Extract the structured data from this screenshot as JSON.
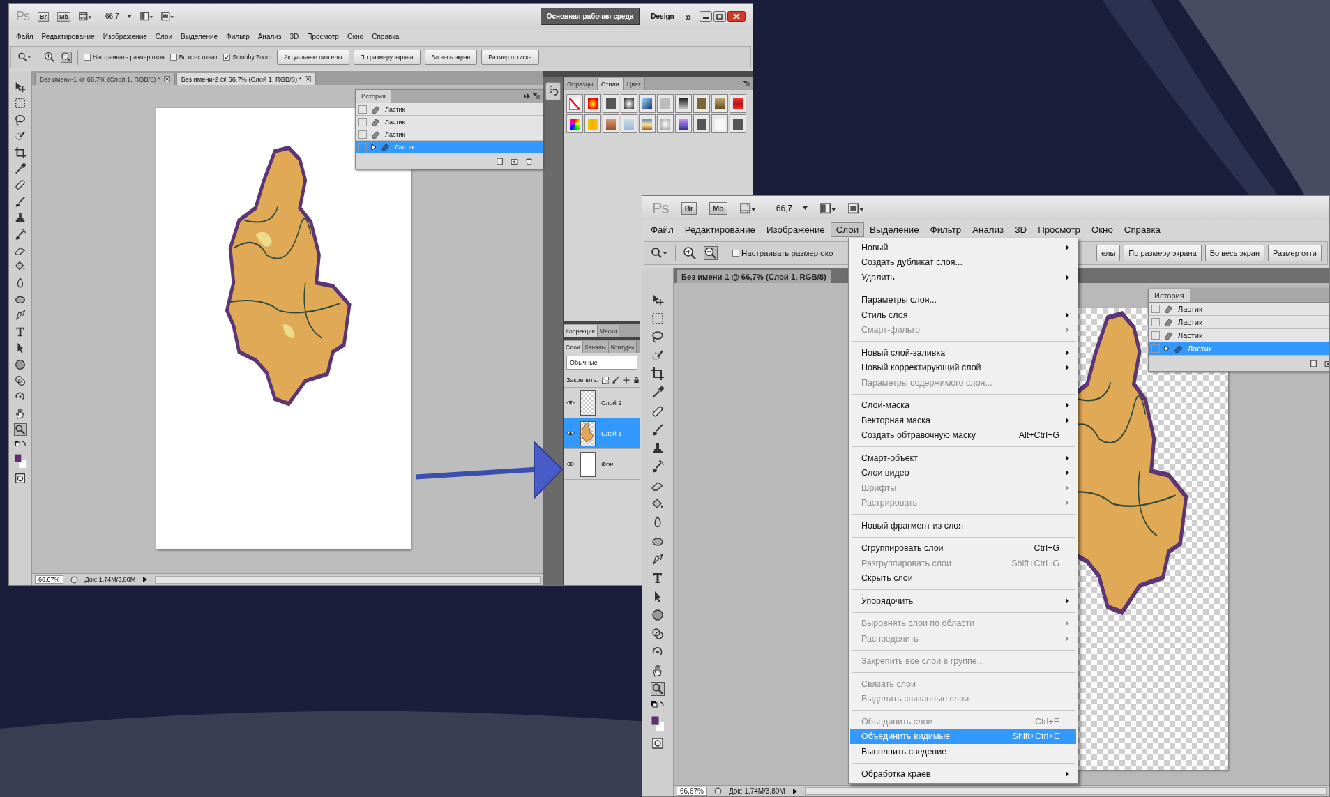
{
  "left_window": {
    "logo": "Ps",
    "bridge": "Br",
    "mini_bridge": "Mb",
    "zoom": "66,7",
    "workspace": "Основная рабочая среда",
    "workspace_alt": "Design",
    "more": "»",
    "menu": [
      {
        "label": "Файл",
        "selected": false
      },
      {
        "label": "Редактирование",
        "selected": false
      },
      {
        "label": "Изображение",
        "selected": false
      },
      {
        "label": "Слои",
        "selected": false
      },
      {
        "label": "Выделение",
        "selected": false
      },
      {
        "label": "Фильтр",
        "selected": false
      },
      {
        "label": "Анализ",
        "selected": false
      },
      {
        "label": "3D",
        "selected": false
      },
      {
        "label": "Просмотр",
        "selected": false
      },
      {
        "label": "Окно",
        "selected": false
      },
      {
        "label": "Справка",
        "selected": false
      }
    ],
    "options": {
      "checkboxes": [
        {
          "label": "Настраивать размер окон",
          "checked": false
        },
        {
          "label": "Во всех окнах",
          "checked": false
        },
        {
          "label": "Scrubby Zoom",
          "checked": true
        }
      ],
      "buttons": [
        "Актуальные пикселы",
        "По размеру экрана",
        "Во весь экран",
        "Размер оттиска"
      ]
    },
    "tabs": [
      {
        "label": "Без имени-1 @ 66,7% (Слой 1, RGB/8) *",
        "selected": false
      },
      {
        "label": "Без имени-2 @ 66,7% (Слой 1, RGB/8) *",
        "selected": true
      }
    ],
    "history": {
      "title": "История",
      "items": [
        {
          "label": "Ластик",
          "selected": false
        },
        {
          "label": "Ластик",
          "selected": false
        },
        {
          "label": "Ластик",
          "selected": false
        },
        {
          "label": "Ластик",
          "selected": true
        }
      ]
    },
    "styles_panel": {
      "tabs": [
        {
          "label": "Образцы",
          "selected": false
        },
        {
          "label": "Стили",
          "selected": true
        },
        {
          "label": "Цвет",
          "selected": false
        }
      ]
    },
    "adjust_panel": {
      "tabs": [
        {
          "label": "Коррекция",
          "selected": true
        },
        {
          "label": "Маски",
          "selected": false
        }
      ]
    },
    "layers_panel": {
      "tabs": [
        {
          "label": "Слои",
          "selected": true
        },
        {
          "label": "Каналы",
          "selected": false
        },
        {
          "label": "Контуры",
          "selected": false
        }
      ],
      "blend_mode": "Обычные",
      "lock_label": "Закрепить:",
      "layers": [
        {
          "name": "Слой 2",
          "kind": "empty",
          "selected": false
        },
        {
          "name": "Слой 1",
          "kind": "map",
          "selected": true
        },
        {
          "name": "Фон",
          "kind": "background",
          "selected": false
        }
      ]
    },
    "status": {
      "zoom": "66,67%",
      "doc": "Док: 1,74M/3,80M"
    }
  },
  "right_window": {
    "logo": "Ps",
    "bridge": "Br",
    "mini_bridge": "Mb",
    "zoom": "66,7",
    "menu": [
      {
        "label": "Файл",
        "selected": false
      },
      {
        "label": "Редактирование",
        "selected": false
      },
      {
        "label": "Изображение",
        "selected": false
      },
      {
        "label": "Слои",
        "selected": true
      },
      {
        "label": "Выделение",
        "selected": false
      },
      {
        "label": "Фильтр",
        "selected": false
      },
      {
        "label": "Анализ",
        "selected": false
      },
      {
        "label": "3D",
        "selected": false
      },
      {
        "label": "Просмотр",
        "selected": false
      },
      {
        "label": "Окно",
        "selected": false
      },
      {
        "label": "Справка",
        "selected": false
      }
    ],
    "options": {
      "checkboxes": [
        {
          "label": "Настраивать размер око",
          "checked": false
        }
      ],
      "buttons": [
        "елы",
        "По размеру экрана",
        "Во весь экран",
        "Размер отти"
      ]
    },
    "tabs": [
      {
        "label": "Без имени-1 @ 66,7% (Слой 1, RGB/8)",
        "selected": true
      }
    ],
    "history": {
      "title": "История",
      "items": [
        {
          "label": "Ластик",
          "selected": false
        },
        {
          "label": "Ластик",
          "selected": false
        },
        {
          "label": "Ластик",
          "selected": false
        },
        {
          "label": "Ластик",
          "selected": true
        }
      ]
    },
    "layer_menu": {
      "groups": [
        [
          {
            "label": "Новый",
            "submenu": true,
            "disabled": false,
            "selected": false
          },
          {
            "label": "Создать дубликат слоя...",
            "submenu": false,
            "disabled": false,
            "selected": false
          },
          {
            "label": "Удалить",
            "submenu": true,
            "disabled": false,
            "selected": false
          }
        ],
        [
          {
            "label": "Параметры слоя...",
            "submenu": false,
            "disabled": false,
            "selected": false
          },
          {
            "label": "Стиль слоя",
            "submenu": true,
            "disabled": false,
            "selected": false
          },
          {
            "label": "Смарт-фильтр",
            "submenu": true,
            "disabled": true,
            "selected": false
          }
        ],
        [
          {
            "label": "Новый слой-заливка",
            "submenu": true,
            "disabled": false,
            "selected": false
          },
          {
            "label": "Новый корректирующий слой",
            "submenu": true,
            "disabled": false,
            "selected": false
          },
          {
            "label": "Параметры содержимого слоя...",
            "submenu": false,
            "disabled": true,
            "selected": false
          }
        ],
        [
          {
            "label": "Слой-маска",
            "submenu": true,
            "disabled": false,
            "selected": false
          },
          {
            "label": "Векторная маска",
            "submenu": true,
            "disabled": false,
            "selected": false
          },
          {
            "label": "Создать обтравочную маску",
            "shortcut": "Alt+Ctrl+G",
            "submenu": false,
            "disabled": false,
            "selected": false
          }
        ],
        [
          {
            "label": "Смарт-объект",
            "submenu": true,
            "disabled": false,
            "selected": false
          },
          {
            "label": "Слои видео",
            "submenu": true,
            "disabled": false,
            "selected": false
          },
          {
            "label": "Шрифты",
            "submenu": true,
            "disabled": true,
            "selected": false
          },
          {
            "label": "Растрировать",
            "submenu": true,
            "disabled": true,
            "selected": false
          }
        ],
        [
          {
            "label": "Новый фрагмент из слоя",
            "submenu": false,
            "disabled": false,
            "selected": false
          }
        ],
        [
          {
            "label": "Сгруппировать слои",
            "shortcut": "Ctrl+G",
            "submenu": false,
            "disabled": false,
            "selected": false
          },
          {
            "label": "Разгруппировать слои",
            "shortcut": "Shift+Ctrl+G",
            "submenu": false,
            "disabled": true,
            "selected": false
          },
          {
            "label": "Скрыть слои",
            "submenu": false,
            "disabled": false,
            "selected": false
          }
        ],
        [
          {
            "label": "Упорядочить",
            "submenu": true,
            "disabled": false,
            "selected": false
          }
        ],
        [
          {
            "label": "Выровнять слои по области",
            "submenu": true,
            "disabled": true,
            "selected": false
          },
          {
            "label": "Распределить",
            "submenu": true,
            "disabled": true,
            "selected": false
          }
        ],
        [
          {
            "label": "Закрепить все слои в группе...",
            "submenu": false,
            "disabled": true,
            "selected": false
          }
        ],
        [
          {
            "label": "Связать слои",
            "submenu": false,
            "disabled": true,
            "selected": false
          },
          {
            "label": "Выделить связанные слои",
            "submenu": false,
            "disabled": true,
            "selected": false
          }
        ],
        [
          {
            "label": "Объединить слои",
            "shortcut": "Ctrl+E",
            "submenu": false,
            "disabled": true,
            "selected": false
          },
          {
            "label": "Объединить видимые",
            "shortcut": "Shift+Ctrl+E",
            "submenu": false,
            "disabled": false,
            "selected": true
          },
          {
            "label": "Выполнить сведение",
            "submenu": false,
            "disabled": false,
            "selected": false
          }
        ],
        [
          {
            "label": "Обработка краев",
            "submenu": true,
            "disabled": false,
            "selected": false
          }
        ]
      ]
    },
    "status": {
      "zoom": "66,67%",
      "doc": "Док: 1,74M/3,80M"
    }
  }
}
